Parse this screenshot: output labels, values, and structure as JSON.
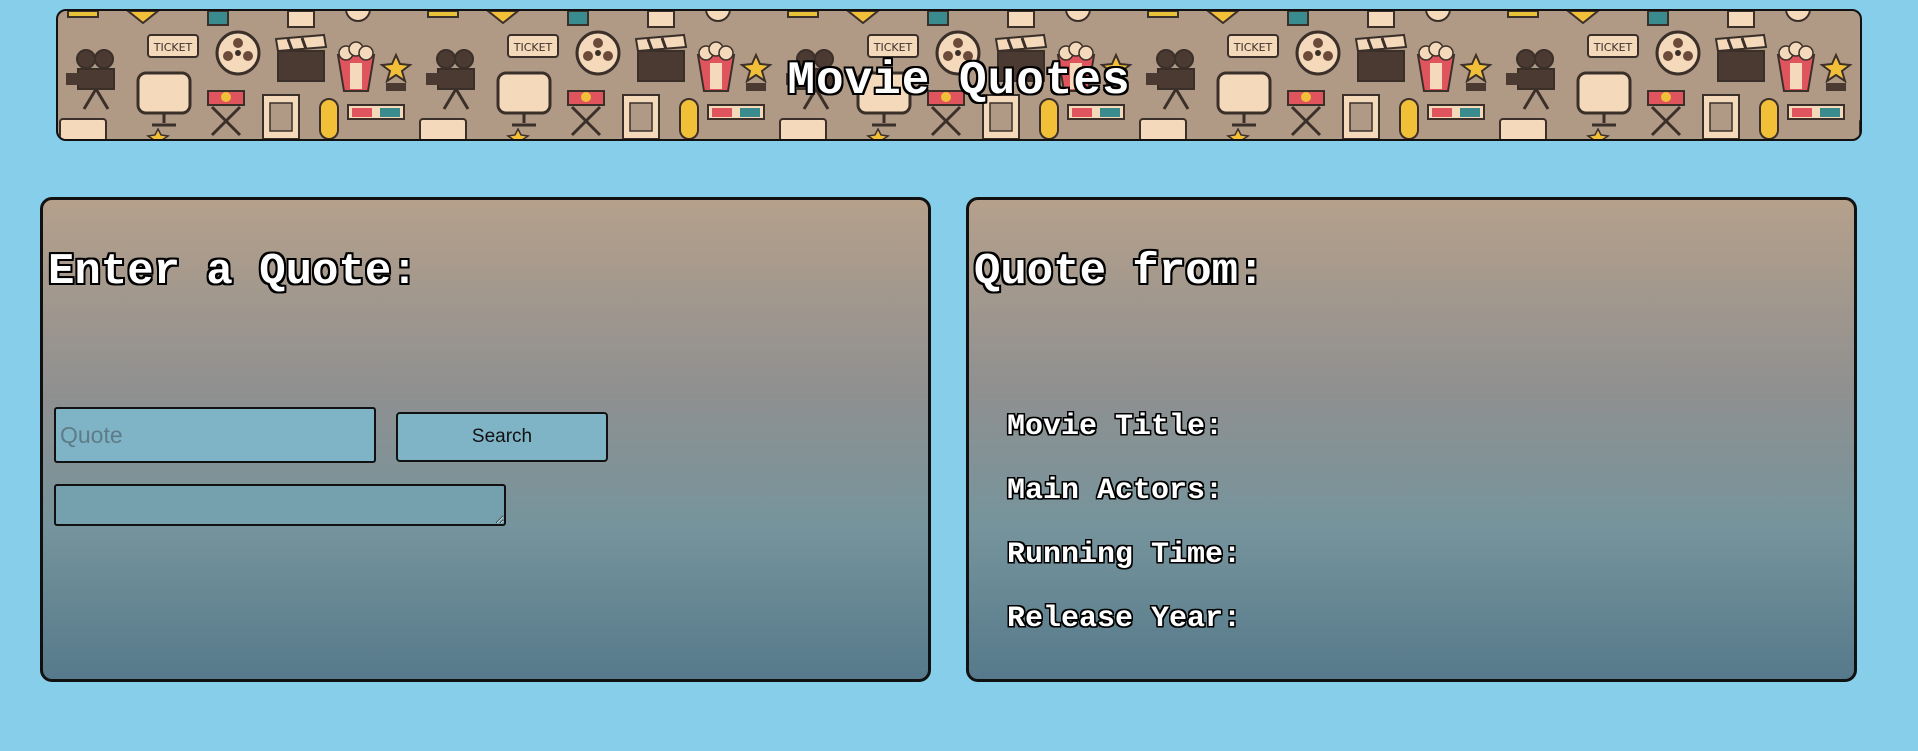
{
  "header": {
    "title": "Movie Quotes",
    "pattern_text": "TICKET",
    "pattern_icons": [
      "film-camera-icon",
      "ticket-icon",
      "film-reel-icon",
      "clapperboard-icon",
      "popcorn-icon",
      "star-award-icon",
      "tv-screen-icon",
      "directors-chair-icon",
      "film-strip-icon",
      "3d-glasses-icon",
      "flag-pennant-icon"
    ]
  },
  "search_panel": {
    "heading": "Enter a Quote:",
    "quote_input": {
      "placeholder": "Quote",
      "value": ""
    },
    "search_button": {
      "label": "Search"
    },
    "result_box": {
      "value": ""
    }
  },
  "result_panel": {
    "heading": "Quote from:",
    "fields": [
      {
        "label": "Movie Title:"
      },
      {
        "label": "Main Actors:"
      },
      {
        "label": "Running Time:"
      },
      {
        "label": "Release Year:"
      }
    ]
  },
  "colors": {
    "page_background": "#87ceeb",
    "banner_background": "#b09a85",
    "panel_gradient_top": "#b5a08b",
    "panel_gradient_bottom": "#567a8b",
    "input_background": "#7fb4c6"
  }
}
